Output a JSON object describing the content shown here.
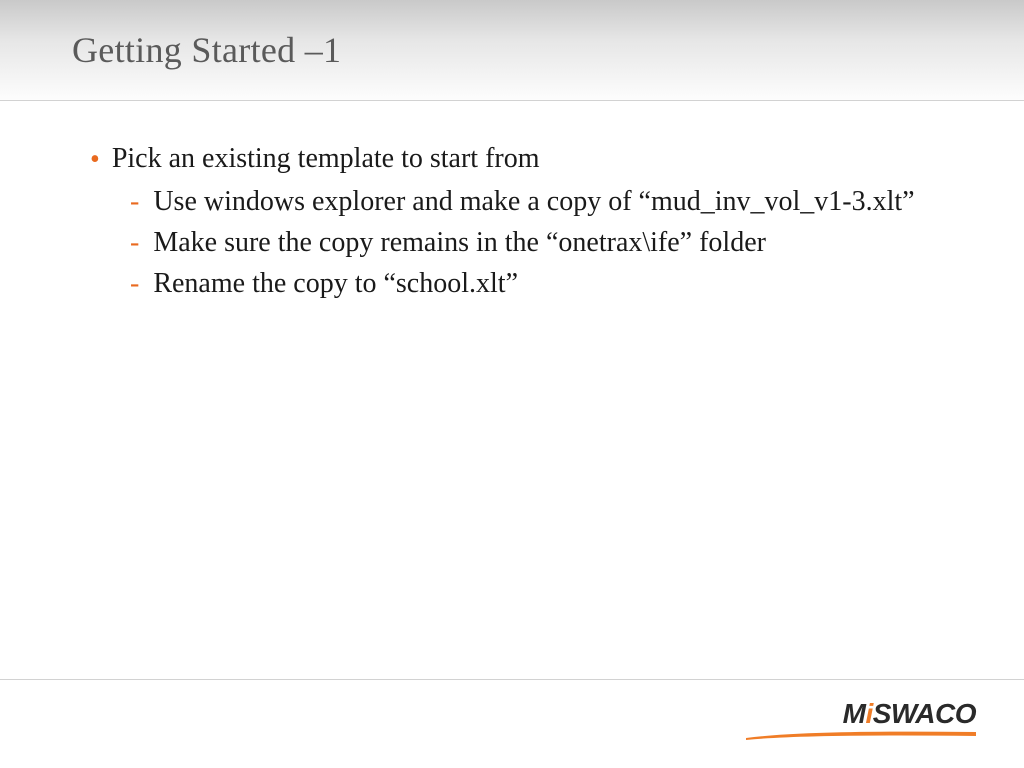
{
  "title": "Getting Started –1",
  "bullets": [
    {
      "text": "Pick an existing template to start from",
      "subs": [
        "Use windows explorer and make a copy of “mud_inv_vol_v1-3.xlt”",
        "Make sure the copy remains in the “onetrax\\ife” folder",
        "Rename the copy to “school.xlt”"
      ]
    }
  ],
  "logo": {
    "prefix": "M",
    "accent": "i",
    "suffix": " SWACO"
  },
  "colors": {
    "accent": "#e96a1f",
    "title_gray": "#5a5a5a"
  }
}
